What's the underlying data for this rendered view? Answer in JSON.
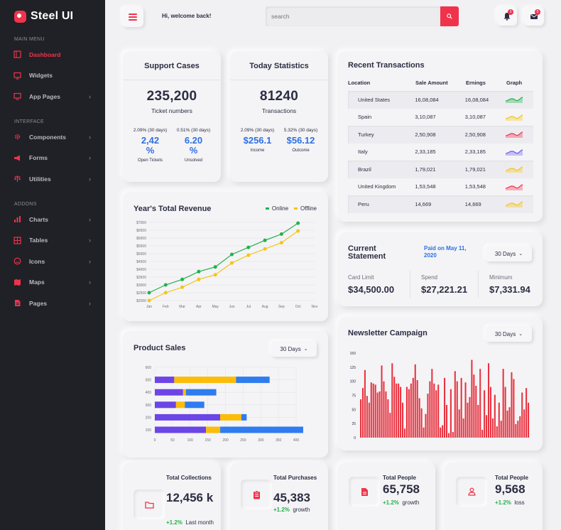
{
  "brand": {
    "name": "Steel UI",
    "color": "#f0334b"
  },
  "sidebar": {
    "sections": [
      {
        "title": "MAIN MENU",
        "items": [
          {
            "label": "Dashboard",
            "icon": "dashboard-icon",
            "active": true,
            "chevron": false
          },
          {
            "label": "Widgets",
            "icon": "monitor-icon",
            "active": false,
            "chevron": false
          },
          {
            "label": "App Pages",
            "icon": "app-pages-icon",
            "active": false,
            "chevron": true
          }
        ]
      },
      {
        "title": "INTERFACE",
        "items": [
          {
            "label": "Components",
            "icon": "gear-icon",
            "active": false,
            "chevron": true
          },
          {
            "label": "Forms",
            "icon": "megaphone-icon",
            "active": false,
            "chevron": true
          },
          {
            "label": "Utilities",
            "icon": "scale-icon",
            "active": false,
            "chevron": true
          }
        ]
      },
      {
        "title": "ADDONS",
        "items": [
          {
            "label": "Charts",
            "icon": "bar-chart-icon",
            "active": false,
            "chevron": true
          },
          {
            "label": "Tables",
            "icon": "table-icon",
            "active": false,
            "chevron": true
          },
          {
            "label": "Icons",
            "icon": "smiley-icon",
            "active": false,
            "chevron": true
          },
          {
            "label": "Maps",
            "icon": "map-icon",
            "active": false,
            "chevron": true
          },
          {
            "label": "Pages",
            "icon": "page-icon",
            "active": false,
            "chevron": true
          }
        ]
      }
    ]
  },
  "header": {
    "welcome": "Hi, welcome back!",
    "search_placeholder": "search",
    "notifications_count": "3",
    "messages_count": "5"
  },
  "support_cases": {
    "title": "Support Cases",
    "value": "235,200",
    "subtitle": "Ticket numbers",
    "cols": [
      {
        "pct": "2.09% (30 days)",
        "value": "2,42 %",
        "label": "Open Tickets"
      },
      {
        "pct": "0.51% (30 days)",
        "value": "6.20 %",
        "label": "Unsolved"
      }
    ]
  },
  "today_stats": {
    "title": "Today Statistics",
    "value": "81240",
    "subtitle": "Transactions",
    "cols": [
      {
        "pct": "2.09% (30 days)",
        "value": "$256.1",
        "label": "Income"
      },
      {
        "pct": "5.32% (30 days)",
        "value": "$56.12",
        "label": "Outcome"
      }
    ]
  },
  "transactions": {
    "title": "Recent Transactions",
    "columns": [
      "Location",
      "Sale Amount",
      "Ernings",
      "Graph"
    ],
    "rows": [
      {
        "location": "United States",
        "amount": "16,08,084",
        "earnings": "16,08,084",
        "graph_color": "#22b14c"
      },
      {
        "location": "Spain",
        "amount": "3,10,087",
        "earnings": "3,10,087",
        "graph_color": "#f5c518"
      },
      {
        "location": "Turkey",
        "amount": "2,50,908",
        "earnings": "2,50,908",
        "graph_color": "#f0334b"
      },
      {
        "location": "Italy",
        "amount": "2,33,185",
        "earnings": "2,33,185",
        "graph_color": "#6b5ce7"
      },
      {
        "location": "Brazil",
        "amount": "1,79,021",
        "earnings": "1,79,021",
        "graph_color": "#f5c518"
      },
      {
        "location": "United Kingdom",
        "amount": "1,53,548",
        "earnings": "1,53,548",
        "graph_color": "#f0334b"
      },
      {
        "location": "Peru",
        "amount": "14,669",
        "earnings": "14,669",
        "graph_color": "#f5c518"
      }
    ]
  },
  "statement": {
    "title": "Current Statement",
    "paid_on": "Paid on May 11, 2020",
    "period": "30 Days",
    "items": [
      {
        "label": "Card Limit",
        "value": "$34,500.00"
      },
      {
        "label": "Spend",
        "value": "$27,221.21"
      },
      {
        "label": "Minimum",
        "value": "$7,331.94"
      }
    ]
  },
  "newsletter": {
    "title": "Newsletter Campaign",
    "period": "30 Days"
  },
  "product_sales": {
    "title": "Product Sales",
    "period": "30 Days"
  },
  "bottom": [
    {
      "title": "Total Collections",
      "value": "12,456 k",
      "change": "+1.2%",
      "note": "Last month",
      "icon": "folder-icon"
    },
    {
      "title": "Total Purchases",
      "value": "45,383",
      "change": "+1.2%",
      "note": "growth",
      "icon": "clipboard-icon"
    },
    {
      "title": "Total People",
      "value": "65,758",
      "change": "+1.2%",
      "note": "growth",
      "icon": "document-icon"
    },
    {
      "title": "Total People",
      "value": "9,568",
      "change": "+1.2%",
      "note": "loss",
      "icon": "user-icon"
    }
  ],
  "chart_data": [
    {
      "type": "line",
      "title": "Year's Total Revenue",
      "categories": [
        "Jan",
        "Feb",
        "Mar",
        "Apr",
        "May",
        "Jun",
        "Jul",
        "Aug",
        "Sep",
        "Oct",
        "Nov"
      ],
      "ylim": [
        2000,
        7000
      ],
      "yticks": [
        "$2000",
        "$2500",
        "$3000",
        "$3500",
        "$4000",
        "$4500",
        "$5000",
        "$5500",
        "$6000",
        "$6500",
        "$7000"
      ],
      "grid": true,
      "legend": "top-right",
      "series": [
        {
          "name": "Online",
          "color": "#22b14c",
          "values": [
            2500,
            3000,
            3350,
            3850,
            4150,
            4950,
            5400,
            5850,
            6250,
            6950
          ]
        },
        {
          "name": "Offline",
          "color": "#f5c518",
          "values": [
            2000,
            2500,
            2850,
            3350,
            3650,
            4400,
            4900,
            5300,
            5700,
            6450
          ]
        }
      ]
    },
    {
      "type": "bar",
      "orientation": "horizontal-stacked",
      "title": "Product Sales",
      "yticks": [
        "600",
        "500",
        "400",
        "300",
        "200",
        "100"
      ],
      "xticks": [
        "0",
        "50",
        "100",
        "150",
        "200",
        "250",
        "300",
        "350",
        "400"
      ],
      "xlim": [
        0,
        400
      ],
      "grid": true,
      "rows": [
        {
          "segments": [
            55,
            175,
            95
          ]
        },
        {
          "segments": [
            80,
            8,
            86
          ]
        },
        {
          "segments": [
            60,
            25,
            55
          ]
        },
        {
          "segments": [
            185,
            60,
            15
          ]
        },
        {
          "segments": [
            145,
            40,
            235
          ]
        }
      ],
      "colors": [
        "#6c45e6",
        "#fbbd08",
        "#2f7cf0"
      ]
    },
    {
      "type": "bar",
      "title": "Newsletter Campaign",
      "ylim": [
        0,
        150
      ],
      "yticks": [
        "0",
        "25",
        "50",
        "75",
        "100",
        "125",
        "150"
      ],
      "color": "#e8323f",
      "values": [
        68,
        88,
        120,
        74,
        62,
        98,
        96,
        94,
        80,
        82,
        128,
        100,
        82,
        68,
        44,
        132,
        108,
        96,
        96,
        90,
        62,
        16,
        90,
        86,
        96,
        106,
        130,
        102,
        70,
        52,
        18,
        42,
        78,
        100,
        122,
        96,
        84,
        94,
        18,
        22,
        106,
        58,
        8,
        86,
        10,
        118,
        100,
        50,
        106,
        34,
        98,
        62,
        72,
        138,
        112,
        92,
        58,
        122,
        14,
        84,
        40,
        132,
        90,
        34,
        76,
        20,
        62,
        30,
        122,
        90,
        48,
        54,
        116,
        104,
        24,
        30,
        38,
        80,
        50,
        88,
        62
      ]
    }
  ]
}
